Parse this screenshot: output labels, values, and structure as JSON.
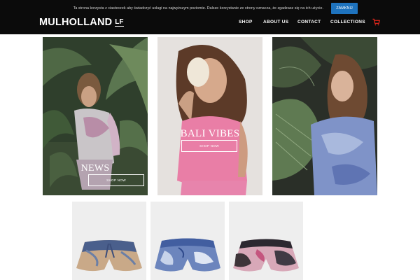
{
  "cookie_bar": {
    "message": "Ta strona korzysta z ciasteczek aby świadczyć usługi na najwyższym poziomie. Dalsze korzystanie ze strony oznacza, że zgadzasz się na ich użycie.",
    "button_label": "ZAMKNIJ"
  },
  "header": {
    "logo_text": "MULHOLLAND",
    "logo_suffix": "LF",
    "nav": [
      "SHOP",
      "ABOUT US",
      "CONTACT",
      "COLLECTIONS"
    ],
    "cart_icon": "shopping-cart-icon",
    "accent_color": "#e0261b"
  },
  "tiles": [
    {
      "title": "NEWS",
      "button": "SHOP NOW"
    },
    {
      "title": "BALI VIBES",
      "button": "SHOP NOW"
    },
    {
      "title": "",
      "button": ""
    }
  ],
  "colors": {
    "header_bg": "#0b0b0b",
    "cookie_button": "#1e73be",
    "product_bg": "#eeeeee"
  }
}
